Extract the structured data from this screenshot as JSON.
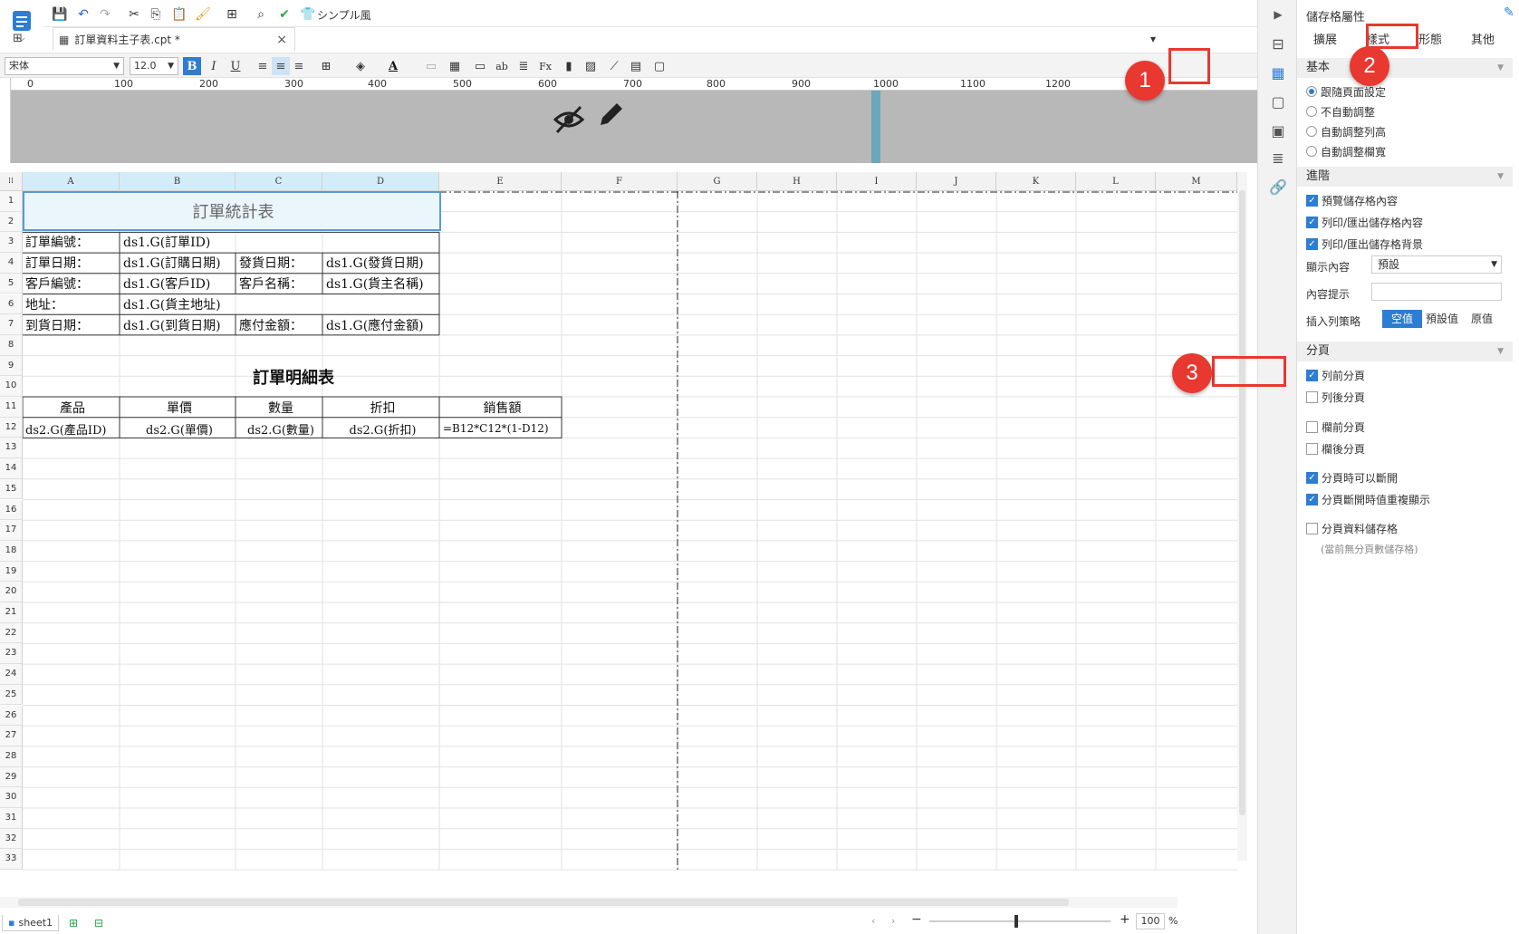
{
  "toolbar": {
    "simple_label": "シンプル風"
  },
  "tab": {
    "filename": "訂單資料主子表.cpt *"
  },
  "format": {
    "font": "宋体",
    "size": "12.0"
  },
  "ruler": {
    "ticks": [
      "0",
      "100",
      "200",
      "300",
      "400",
      "500",
      "600",
      "700",
      "800",
      "900",
      "1000",
      "1100",
      "1200"
    ]
  },
  "columns": [
    "A",
    "B",
    "C",
    "D",
    "E",
    "F",
    "G",
    "H",
    "I",
    "J",
    "K",
    "L",
    "M"
  ],
  "rows": [
    "1",
    "2",
    "3",
    "4",
    "5",
    "6",
    "7",
    "8",
    "9",
    "10",
    "11",
    "12",
    "13",
    "14",
    "15",
    "16",
    "17",
    "18",
    "19",
    "20",
    "21",
    "22",
    "23",
    "24",
    "25",
    "26",
    "27",
    "28",
    "29",
    "30",
    "31",
    "32",
    "33"
  ],
  "cells": {
    "title": "訂單統計表",
    "order_no_label": "訂單編號：",
    "order_no_value": "ds1.G(訂單ID)",
    "order_date_label": "訂單日期：",
    "order_date_value": "ds1.G(訂購日期)",
    "ship_date_label": "發貨日期：",
    "ship_date_value": "ds1.G(發貨日期)",
    "customer_no_label": "客戶編號：",
    "customer_no_value": "ds1.G(客戶ID)",
    "customer_name_label": "客戶名稱：",
    "customer_name_value": "ds1.G(貨主名稱)",
    "address_label": "地址：",
    "address_value": "ds1.G(貨主地址)",
    "arrival_label": "到貨日期：",
    "arrival_value": "ds1.G(到貨日期)",
    "payable_label": "應付金額：",
    "payable_value": "ds1.G(應付金額)",
    "detail_title": "訂單明細表",
    "h_product": "產品",
    "h_price": "單價",
    "h_qty": "數量",
    "h_discount": "折扣",
    "h_sales": "銷售額",
    "d_product": "ds2.G(產品ID)",
    "d_price": "ds2.G(單價)",
    "d_qty": "ds2.G(數量)",
    "d_discount": "ds2.G(折扣)",
    "d_sales": "=B12*C12*(1-D12)"
  },
  "panel": {
    "title": "儲存格屬性",
    "tabs": [
      "擴展",
      "樣式",
      "形態",
      "其他"
    ],
    "basic": "基本",
    "basic_opts": [
      "跟隨頁面設定",
      "不自動調整",
      "自動調整列高",
      "自動調整欄寬"
    ],
    "advanced": "進階",
    "adv_opts": [
      "預覽儲存格內容",
      "列印/匯出儲存格內容",
      "列印/匯出儲存格背景"
    ],
    "display_label": "顯示內容",
    "display_value": "預設",
    "hint_label": "內容提示",
    "insert_label": "插入列策略",
    "insert_opts": [
      "空值",
      "預設值",
      "原值"
    ],
    "paging": "分頁",
    "page_opts": [
      "列前分頁",
      "列後分頁",
      "欄前分頁",
      "欄後分頁",
      "分頁時可以斷開",
      "分頁斷開時值重複顯示",
      "分頁資料儲存格"
    ],
    "page_note": "(當前無分頁數儲存格)"
  },
  "annotations": [
    "1",
    "2",
    "3"
  ],
  "bottom": {
    "sheet": "sheet1",
    "zoom": "100",
    "pct": "%"
  },
  "colors": {
    "accent": "#2d7dd2",
    "annotation": "#e8382f",
    "selected_col": "#d4ecf8"
  }
}
